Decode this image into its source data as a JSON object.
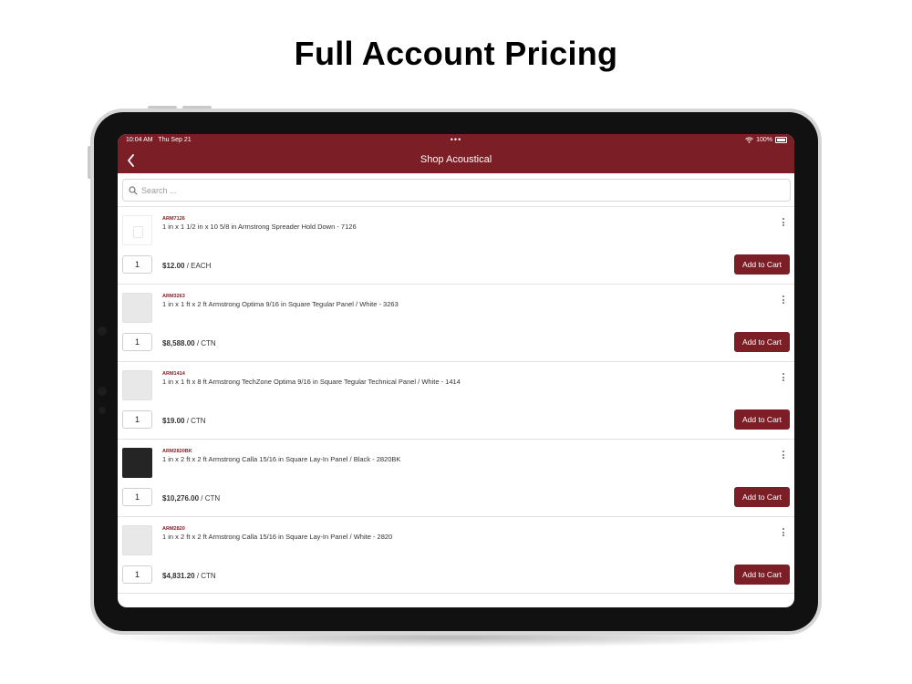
{
  "headline": "Full Account Pricing",
  "status_bar": {
    "time": "10:04 AM",
    "date": "Thu Sep 21",
    "dots": "•••",
    "battery": "100%"
  },
  "navbar": {
    "title": "Shop Acoustical",
    "back_icon": "chevron-left-icon"
  },
  "search": {
    "placeholder": "Search ...",
    "value": ""
  },
  "colors": {
    "brand": "#7b1e26",
    "background": "#ffffff"
  },
  "products": [
    {
      "sku": "ARM7126",
      "name": "1 in x 1 1/2 in x 10 5/8 in Armstrong Spreader Hold Down - 7126",
      "qty": "1",
      "price": "$12.00",
      "unit": " / EACH",
      "button": "Add to Cart",
      "thumb": "blank"
    },
    {
      "sku": "ARM3263",
      "name": "1 in x 1 ft x 2 ft Armstrong Optima 9/16 in Square Tegular Panel / White - 3263",
      "qty": "1",
      "price": "$8,588.00",
      "unit": " / CTN",
      "button": "Add to Cart",
      "thumb": "white"
    },
    {
      "sku": "ARM1414",
      "name": "1 in x 1 ft x 8 ft Armstrong TechZone Optima 9/16 in Square Tegular Technical Panel / White - 1414",
      "qty": "1",
      "price": "$19.00",
      "unit": " / CTN",
      "button": "Add to Cart",
      "thumb": "white"
    },
    {
      "sku": "ARM2820BK",
      "name": "1 in x 2 ft x 2 ft Armstrong Calla 15/16 in Square Lay-In Panel / Black - 2820BK",
      "qty": "1",
      "price": "$10,276.00",
      "unit": " / CTN",
      "button": "Add to Cart",
      "thumb": "black"
    },
    {
      "sku": "ARM2820",
      "name": "1 in x 2 ft x 2 ft Armstrong Calla 15/16 in Square Lay-In Panel / White - 2820",
      "qty": "1",
      "price": "$4,831.20",
      "unit": " / CTN",
      "button": "Add to Cart",
      "thumb": "white"
    }
  ]
}
